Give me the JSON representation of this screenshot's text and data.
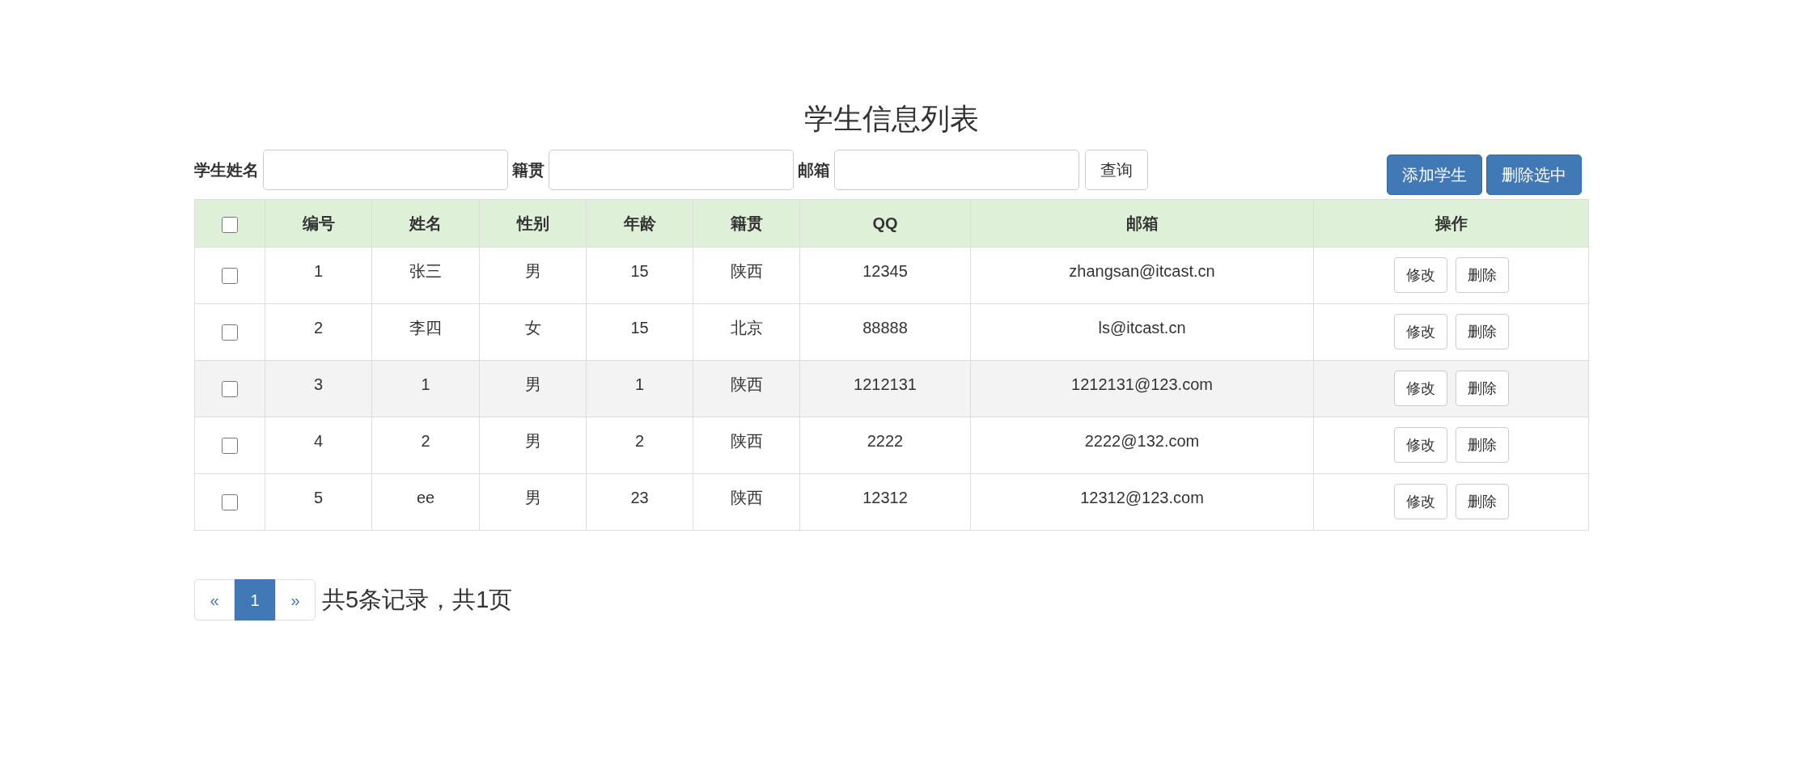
{
  "title": "学生信息列表",
  "search": {
    "fields": [
      {
        "label": "学生姓名"
      },
      {
        "label": "籍贯"
      },
      {
        "label": "邮箱"
      }
    ],
    "button": "查询"
  },
  "actions": [
    "添加学生",
    "删除选中"
  ],
  "table": {
    "select_all_checked": false,
    "columns": [
      "编号",
      "姓名",
      "性别",
      "年龄",
      "籍贯",
      "QQ",
      "邮箱",
      "操作"
    ],
    "rows": [
      {
        "checked": false,
        "highlighted": false,
        "cells": [
          "1",
          "张三",
          "男",
          "15",
          "陕西",
          "12345",
          "zhangsan@itcast.cn"
        ],
        "buttons": [
          "修改",
          "删除"
        ]
      },
      {
        "checked": false,
        "highlighted": false,
        "cells": [
          "2",
          "李四",
          "女",
          "15",
          "北京",
          "88888",
          "ls@itcast.cn"
        ],
        "buttons": [
          "修改",
          "删除"
        ]
      },
      {
        "checked": false,
        "highlighted": true,
        "cells": [
          "3",
          "1",
          "男",
          "1",
          "陕西",
          "1212131",
          "1212131@123.com"
        ],
        "buttons": [
          "修改",
          "删除"
        ]
      },
      {
        "checked": false,
        "highlighted": false,
        "cells": [
          "4",
          "2",
          "男",
          "2",
          "陕西",
          "2222",
          "2222@132.com"
        ],
        "buttons": [
          "修改",
          "删除"
        ]
      },
      {
        "checked": false,
        "highlighted": false,
        "cells": [
          "5",
          "ee",
          "男",
          "23",
          "陕西",
          "12312",
          "12312@123.com"
        ],
        "buttons": [
          "修改",
          "删除"
        ]
      }
    ]
  },
  "pagination": {
    "prev": "«",
    "pages": [
      {
        "label": "1",
        "selected": true
      }
    ],
    "next": "»",
    "summary": "共5条记录，共1页"
  }
}
